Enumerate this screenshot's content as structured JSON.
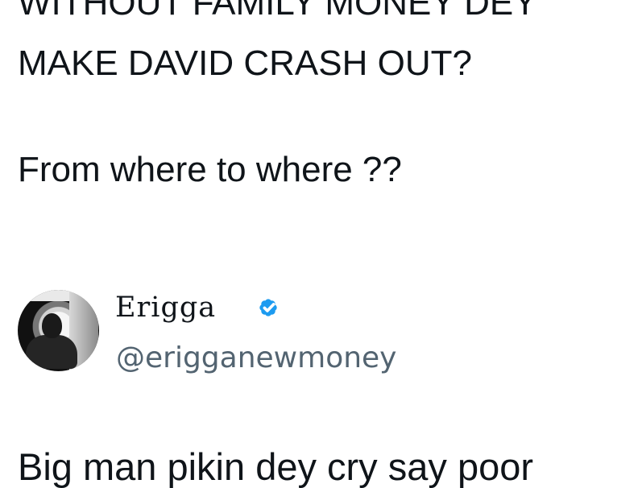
{
  "post": {
    "lines": [
      "WITHOUT FAMILY MONEY DEY",
      "MAKE DAVID CRASH OUT?",
      "From where to where ??"
    ]
  },
  "author": {
    "display_name": "Erigga",
    "handle": "@erigganewmoney",
    "verified_icon": "verified-badge-icon",
    "verified_color": "#1d9bf0"
  },
  "reply": {
    "text": "Big man pikin dey cry say poor"
  }
}
